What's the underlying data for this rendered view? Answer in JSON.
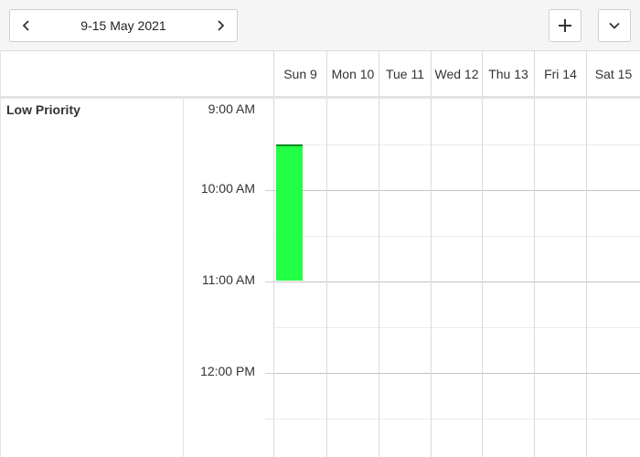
{
  "toolbar": {
    "date_range": "9-15 May 2021",
    "prev_icon": "chevron-left-icon",
    "next_icon": "chevron-right-icon",
    "add_icon": "plus-icon",
    "more_icon": "chevron-down-icon"
  },
  "days": [
    "Sun 9",
    "Mon 10",
    "Tue 11",
    "Wed 12",
    "Thu 13",
    "Fri 14",
    "Sat 15"
  ],
  "resource": {
    "name": "Low Priority"
  },
  "times": [
    "9:00 AM",
    "10:00 AM",
    "11:00 AM",
    "12:00 PM"
  ],
  "event": {
    "color": "#22ff44",
    "border_color": "#0a8a1f",
    "day": "Sun 9"
  }
}
